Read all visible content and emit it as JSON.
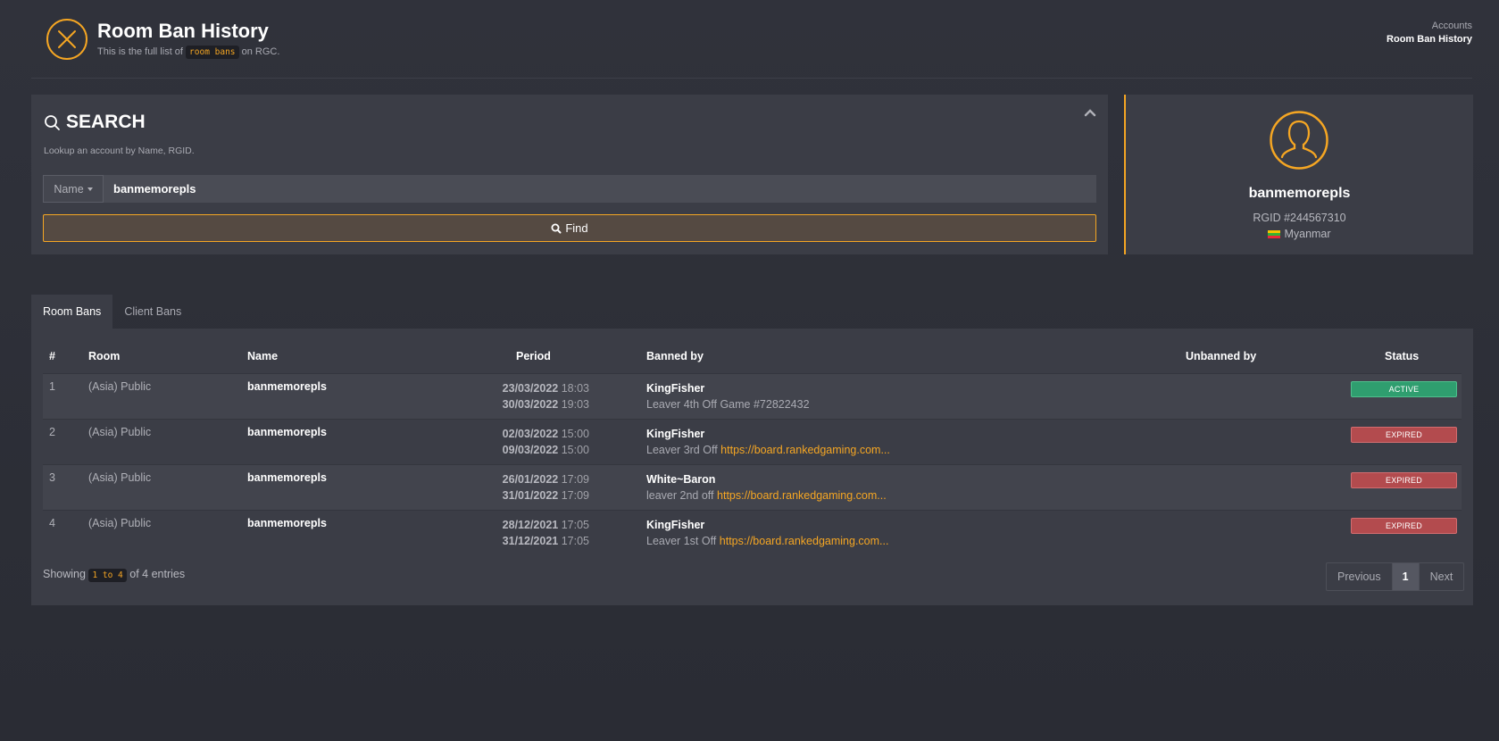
{
  "header": {
    "title": "Room Ban History",
    "subtitle_pre": "This is the full list of",
    "subtitle_code": "room bans",
    "subtitle_post": "on RGC.",
    "logo_icon": "x-circle-icon"
  },
  "breadcrumbs": [
    "Accounts",
    "Room Ban History"
  ],
  "search": {
    "title": "SEARCH",
    "description": "Lookup an account by Name, RGID.",
    "field_type": "Name",
    "value": "banmemorepls",
    "find_label": "Find"
  },
  "profile": {
    "name": "banmemorepls",
    "rgid": "RGID #244567310",
    "country": "Myanmar"
  },
  "tabs": [
    {
      "label": "Room Bans",
      "active": true
    },
    {
      "label": "Client Bans",
      "active": false
    }
  ],
  "table": {
    "headers": [
      "#",
      "Room",
      "Name",
      "Period",
      "Banned by",
      "Unbanned by",
      "Status"
    ],
    "rows": [
      {
        "num": "1",
        "room": "(Asia) Public",
        "name": "banmemorepls",
        "start_date": "23/03/2022",
        "start_time": "18:03",
        "end_date": "30/03/2022",
        "end_time": "19:03",
        "banned_by": "KingFisher",
        "reason": "Leaver 4th Off Game #72822432",
        "link": "",
        "unbanned_by": "",
        "status": "ACTIVE"
      },
      {
        "num": "2",
        "room": "(Asia) Public",
        "name": "banmemorepls",
        "start_date": "02/03/2022",
        "start_time": "15:00",
        "end_date": "09/03/2022",
        "end_time": "15:00",
        "banned_by": "KingFisher",
        "reason": "Leaver 3rd Off",
        "link": "https://board.rankedgaming.com...",
        "unbanned_by": "",
        "status": "EXPIRED"
      },
      {
        "num": "3",
        "room": "(Asia) Public",
        "name": "banmemorepls",
        "start_date": "26/01/2022",
        "start_time": "17:09",
        "end_date": "31/01/2022",
        "end_time": "17:09",
        "banned_by": "White~Baron",
        "reason": "leaver 2nd off",
        "link": "https://board.rankedgaming.com...",
        "unbanned_by": "",
        "status": "EXPIRED"
      },
      {
        "num": "4",
        "room": "(Asia) Public",
        "name": "banmemorepls",
        "start_date": "28/12/2021",
        "start_time": "17:05",
        "end_date": "31/12/2021",
        "end_time": "17:05",
        "banned_by": "KingFisher",
        "reason": "Leaver 1st Off",
        "link": "https://board.rankedgaming.com...",
        "unbanned_by": "",
        "status": "EXPIRED"
      }
    ]
  },
  "footer": {
    "showing_pre": "Showing",
    "showing_range": "1 to 4",
    "showing_post": "of 4 entries"
  },
  "pagination": {
    "previous": "Previous",
    "current": "1",
    "next": "Next"
  },
  "colors": {
    "accent": "#f5a623",
    "active": "#2f9e6f",
    "expired": "#b34b4e"
  }
}
